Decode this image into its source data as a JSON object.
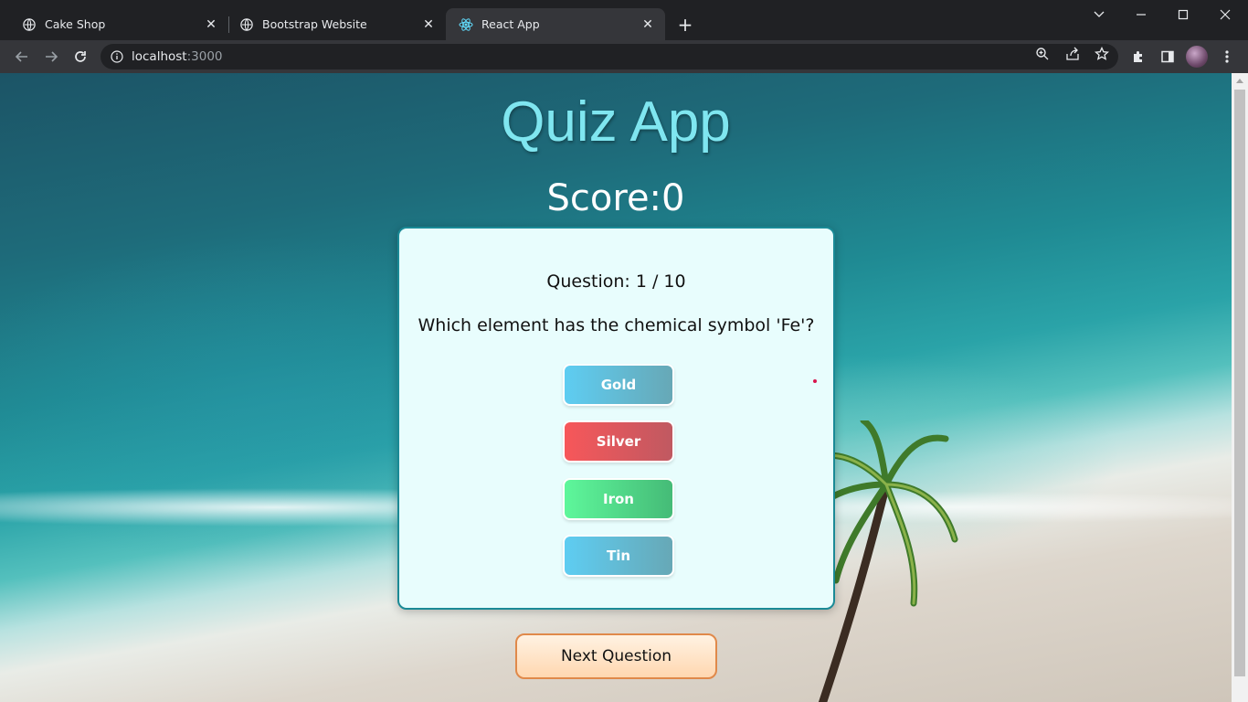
{
  "browser": {
    "tabs": [
      {
        "label": "Cake Shop",
        "active": false,
        "icon": "globe-icon"
      },
      {
        "label": "Bootstrap Website",
        "active": false,
        "icon": "globe-icon"
      },
      {
        "label": "React App",
        "active": true,
        "icon": "react-icon"
      }
    ],
    "url_host": "localhost",
    "url_port": ":3000"
  },
  "quiz": {
    "title": "Quiz App",
    "score_label": "Score:0",
    "question_number": "Question: 1 / 10",
    "question_text": "Which element has the chemical symbol 'Fe'?",
    "options": [
      "Gold",
      "Silver",
      "Iron",
      "Tin"
    ],
    "option_colors": [
      "blue",
      "red",
      "green",
      "blue"
    ],
    "next_label": "Next Question"
  },
  "colors": {
    "title": "#7fe6f0",
    "card_bg": "#e8fdfd",
    "card_border": "#1a8a96",
    "next_border": "#e0894a",
    "wrong_option": "#f7575a",
    "correct_option": "#5ef79b"
  }
}
